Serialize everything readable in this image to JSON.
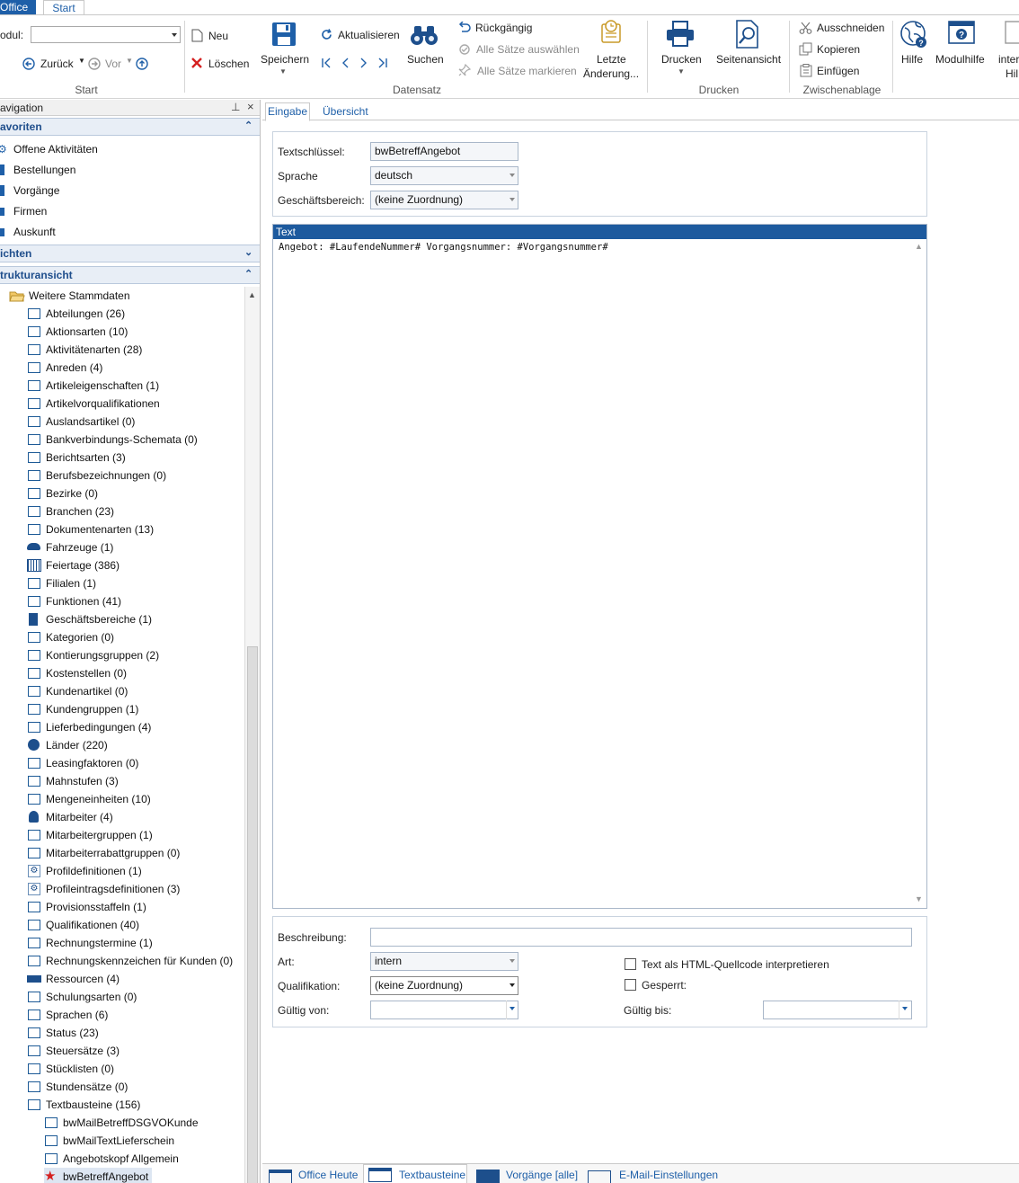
{
  "ribbon": {
    "tabs": [
      "Office",
      "Start"
    ],
    "modul_label": "odul:",
    "back_label": "Zurück",
    "forward_label": "Vor",
    "start_group": "Start",
    "new_label": "Neu",
    "delete_label": "Löschen",
    "save_label": "Speichern",
    "refresh_label": "Aktualisieren",
    "search_label": "Suchen",
    "undo_label": "Rückgängig",
    "select_all_label": "Alle Sätze auswählen",
    "mark_all_label": "Alle Sätze markieren",
    "last_change_line1": "Letzte",
    "last_change_line2": "Änderung...",
    "datensatz_group": "Datensatz",
    "print_label": "Drucken",
    "page_view_label": "Seitenansicht",
    "print_group": "Drucken",
    "cut_label": "Ausschneiden",
    "copy_label": "Kopieren",
    "paste_label": "Einfügen",
    "clipboard_group": "Zwischenablage",
    "help_label": "Hilfe",
    "modulhilfe_label": "Modulhilfe",
    "inter_line1": "inter",
    "inter_line2": "Hil"
  },
  "nav": {
    "title": "avigation",
    "favoriten": "avoriten",
    "favorites": [
      "Offene Aktivitäten",
      "Bestellungen",
      "Vorgänge",
      "Firmen",
      "Auskunft"
    ],
    "sichten": "ichten",
    "struktur": "trukturansicht",
    "root_folder": "Weitere Stammdaten",
    "tree": [
      "Abteilungen (26)",
      "Aktionsarten (10)",
      "Aktivitätenarten (28)",
      "Anreden (4)",
      "Artikeleigenschaften (1)",
      "Artikelvorqualifikationen",
      "Auslandsartikel (0)",
      "Bankverbindungs-Schemata (0)",
      "Berichtsarten (3)",
      "Berufsbezeichnungen (0)",
      "Bezirke (0)",
      "Branchen (23)",
      "Dokumentenarten (13)",
      "Fahrzeuge (1)",
      "Feiertage (386)",
      "Filialen (1)",
      "Funktionen (41)",
      "Geschäftsbereiche (1)",
      "Kategorien (0)",
      "Kontierungsgruppen (2)",
      "Kostenstellen (0)",
      "Kundenartikel (0)",
      "Kundengruppen (1)",
      "Lieferbedingungen (4)",
      "Länder (220)",
      "Leasingfaktoren (0)",
      "Mahnstufen (3)",
      "Mengeneinheiten (10)",
      "Mitarbeiter (4)",
      "Mitarbeitergruppen (1)",
      "Mitarbeiterrabattgruppen (0)",
      "Profildefinitionen (1)",
      "Profileintragsdefinitionen (3)",
      "Provisionsstaffeln (1)",
      "Qualifikationen (40)",
      "Rechnungstermine (1)",
      "Rechnungskennzeichen für Kunden (0)",
      "Ressourcen (4)",
      "Schulungsarten (0)",
      "Sprachen (6)",
      "Status (23)",
      "Steuersätze (3)",
      "Stücklisten (0)",
      "Stundensätze (0)",
      "Textbausteine (156)"
    ],
    "sub": [
      "bwMailBetreffDSGVOKunde",
      "bwMailTextLieferschein",
      "Angebotskopf Allgemein",
      "bwBetreffAngebot"
    ]
  },
  "content": {
    "tabs": [
      "Eingabe",
      "Übersicht"
    ],
    "textschluessel_label": "Textschlüssel:",
    "textschluessel_value": "bwBetreffAngebot",
    "sprache_label": "Sprache",
    "sprache_value": "deutsch",
    "gb_label": "Geschäftsbereich:",
    "gb_value": "(keine Zuordnung)",
    "text_header": "Text",
    "text_value": "Angebot: #LaufendeNummer# Vorgangsnummer: #Vorgangsnummer#",
    "beschreibung_label": "Beschreibung:",
    "beschreibung_value": "",
    "art_label": "Art:",
    "art_value": "intern",
    "qual_label": "Qualifikation:",
    "qual_value": "(keine Zuordnung)",
    "gueltig_von_label": "Gültig von:",
    "gueltig_bis_label": "Gültig bis:",
    "html_label": "Text als HTML-Quellcode interpretieren",
    "gesperrt_label": "Gesperrt:"
  },
  "bottom_tabs": [
    "Office Heute",
    "Textbausteine",
    "Vorgänge [alle]",
    "E-Mail-Einstellungen"
  ]
}
